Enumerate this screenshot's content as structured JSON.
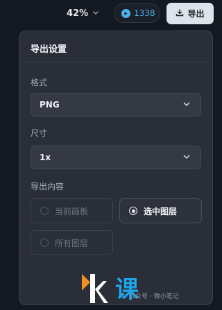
{
  "toolbar": {
    "zoom_value": "42%",
    "credits_value": "1338",
    "export_label": "导出"
  },
  "panel": {
    "title": "导出设置",
    "format": {
      "label": "格式",
      "selected": "PNG"
    },
    "size": {
      "label": "尺寸",
      "selected": "1x"
    },
    "content": {
      "label": "导出内容",
      "options": [
        {
          "label": "当前画板",
          "selected": false
        },
        {
          "label": "选中图层",
          "selected": true
        },
        {
          "label": "所有图层",
          "selected": false
        }
      ]
    }
  },
  "watermark": {
    "text": "公众号 · 微小笔记",
    "logo_text": "课"
  },
  "colors": {
    "background": "#141821",
    "panel": "#2a2e38",
    "accent_credits": "#4fb1ea",
    "export_button": "#dde3ea",
    "watermark_orange": "#f0901e",
    "watermark_blue": "#1fa4e8"
  }
}
